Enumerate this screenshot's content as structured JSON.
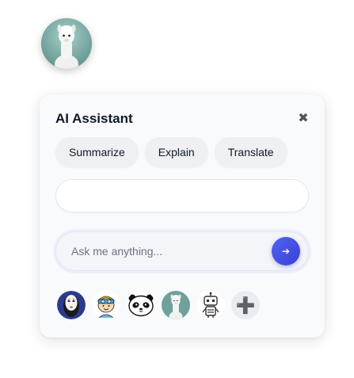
{
  "launcher": {
    "icon": "alpaca-avatar-icon"
  },
  "panel": {
    "title": "AI Assistant",
    "close_glyph": "✖",
    "close_icon": "close-icon"
  },
  "actions": [
    {
      "label": "Summarize"
    },
    {
      "label": "Explain"
    },
    {
      "label": "Translate"
    }
  ],
  "output": {
    "value": ""
  },
  "input": {
    "placeholder": "Ask me anything...",
    "value": "",
    "send_glyph": "➔",
    "send_icon": "send-arrow-icon"
  },
  "avatars": [
    {
      "icon": "no-face-spirit-avatar-icon"
    },
    {
      "icon": "cartoon-boy-goggles-avatar-icon"
    },
    {
      "icon": "panda-avatar-icon"
    },
    {
      "icon": "alpaca-avatar-icon",
      "selected": true
    },
    {
      "icon": "robot-avatar-icon"
    },
    {
      "icon": "plus-icon",
      "glyph": "➕"
    }
  ],
  "colors": {
    "accent": "#4550e6",
    "panel_bg": "#f8fafc",
    "button_bg": "#eef0f3"
  }
}
